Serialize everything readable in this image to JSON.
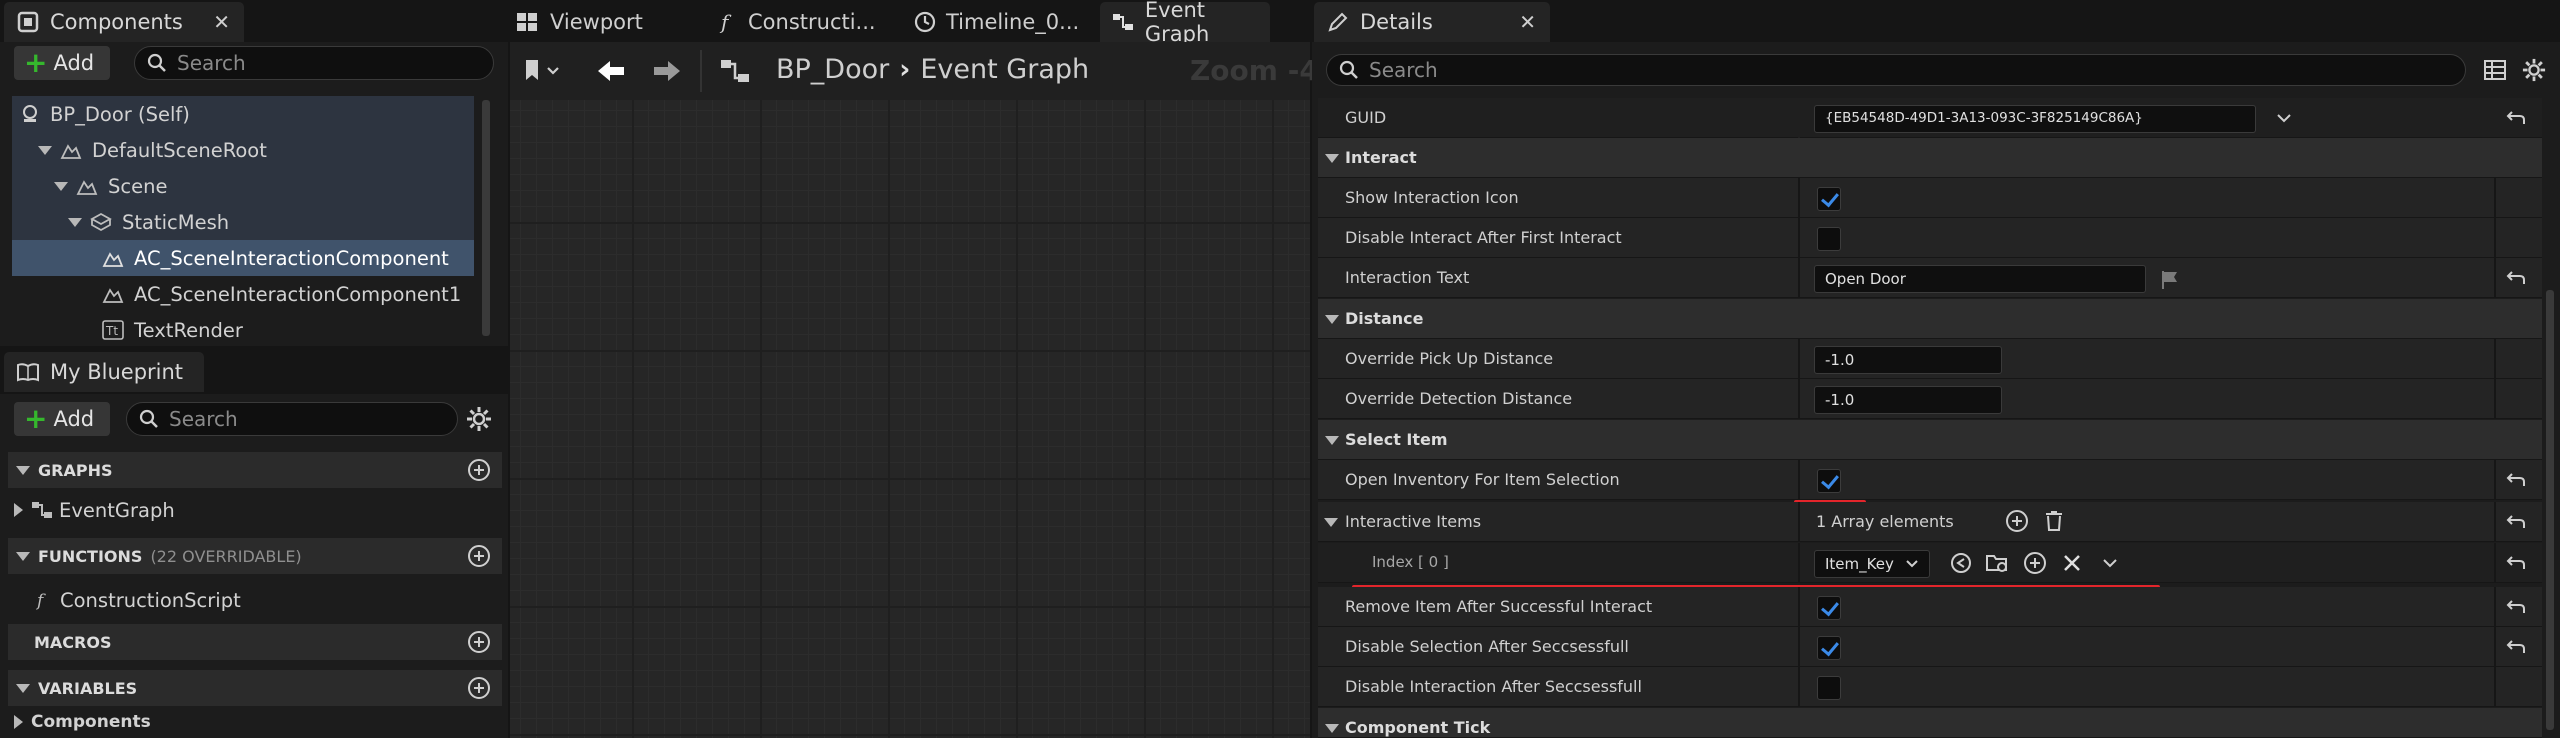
{
  "components_panel": {
    "tab_title": "Components",
    "add_label": "Add",
    "search_placeholder": "Search",
    "tree": [
      {
        "label": "BP_Door (Self)"
      },
      {
        "label": "DefaultSceneRoot"
      },
      {
        "label": "Scene"
      },
      {
        "label": "StaticMesh"
      },
      {
        "label": "AC_SceneInteractionComponent"
      },
      {
        "label": "AC_SceneInteractionComponent1"
      },
      {
        "label": "TextRender"
      }
    ]
  },
  "my_blueprint_panel": {
    "tab_title": "My Blueprint",
    "add_label": "Add",
    "search_placeholder": "Search",
    "sections": {
      "graphs": "GRAPHS",
      "graphs_item": "EventGraph",
      "functions": "FUNCTIONS",
      "functions_count": "(22 OVERRIDABLE)",
      "functions_item": "ConstructionScript",
      "macros": "MACROS",
      "variables": "VARIABLES",
      "variables_item": "Components"
    }
  },
  "editor_tabs": {
    "viewport": "Viewport",
    "construction": "Constructi...",
    "timeline": "Timeline_0...",
    "event_graph": "Event Graph"
  },
  "graph": {
    "breadcrumb_root": "BP_Door",
    "breadcrumb_sep": ">",
    "breadcrumb_current": "Event Graph",
    "zoom": "Zoom -4"
  },
  "details": {
    "tab_title": "Details",
    "search_placeholder": "Search",
    "guid_label": "GUID",
    "guid_value": "{EB54548D-49D1-3A13-093C-3F825149C86A}",
    "interact_header": "Interact",
    "show_icon_label": "Show Interaction Icon",
    "disable_after_first_label": "Disable Interact After First Interact",
    "interaction_text_label": "Interaction Text",
    "interaction_text_value": "Open Door",
    "distance_header": "Distance",
    "pickup_label": "Override Pick Up Distance",
    "pickup_value": "-1.0",
    "detection_label": "Override Detection Distance",
    "detection_value": "-1.0",
    "select_item_header": "Select Item",
    "open_inventory_label": "Open Inventory For Item Selection",
    "interactive_items_label": "Interactive Items",
    "interactive_items_count": "1 Array elements",
    "index_label": "Index [ 0 ]",
    "index_value": "Item_Key",
    "remove_item_label": "Remove Item After Successful Interact",
    "disable_selection_label": "Disable Selection After Seccsessfull",
    "disable_interaction_label": "Disable Interaction After Seccsessfull",
    "component_tick_header": "Component Tick"
  },
  "checkbox_states": {
    "show_icon": true,
    "disable_after_first": false,
    "open_inventory": true,
    "remove_item": true,
    "disable_selection": true,
    "disable_interaction": false
  },
  "colors": {
    "accent_blue": "#3b8ae8",
    "add_green": "#35b72d",
    "annotation_red": "#e3252b",
    "selection": "#40536b"
  }
}
